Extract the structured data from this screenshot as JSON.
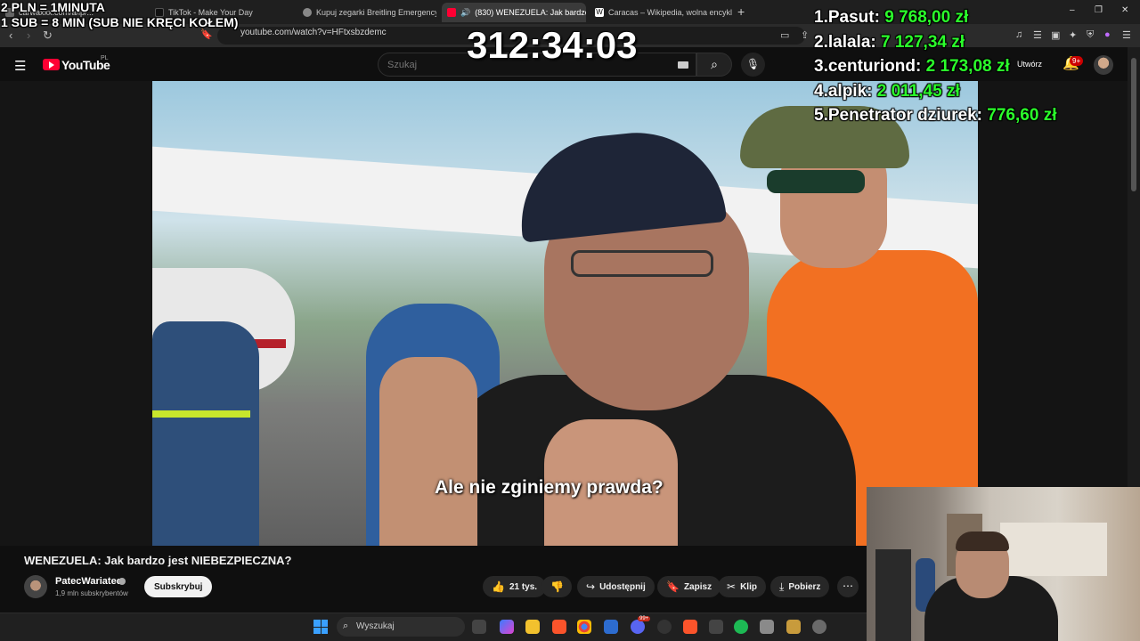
{
  "browser": {
    "tabs": [
      {
        "label": "carwaxxx.com/a/lp/... ",
        "active": false
      },
      {
        "label": "TikTok - Make Your Day",
        "active": false
      },
      {
        "label": "Kupuj zegarki Breitling Emergency II",
        "active": false
      },
      {
        "label": "(830) WENEZUELA: Jak bardzo",
        "active": true
      },
      {
        "label": "Caracas – Wikipedia, wolna encyklop",
        "active": false
      }
    ],
    "new_tab": "+",
    "url": "youtube.com/watch?v=HFtxsbzdemc",
    "window_controls": [
      "–",
      "❐",
      "✕"
    ]
  },
  "youtube": {
    "logo_text": "YouTube",
    "region": "PL",
    "search_placeholder": "Szukaj",
    "create_label": "Utwórz",
    "notifications_badge": "9+",
    "subtitle": "Ale nie zginiemy prawda?",
    "video_title": "WENEZUELA: Jak bardzo jest NIEBEZPIECZNA?",
    "channel_name": "PatecWariatec",
    "channel_subs": "1,9 mln subskrybentów",
    "subscribe_label": "Subskrybuj",
    "likes": "21 tys.",
    "share_label": "Udostępnij",
    "save_label": "Zapisz",
    "clip_label": "Klip",
    "download_label": "Pobierz"
  },
  "overlay": {
    "line1": "2 PLN = 1MINUTA",
    "line2": "1 SUB = 8 MIN (SUB NIE KRĘCI KOŁEM)",
    "timer": "312:34:03",
    "leaderboard": [
      {
        "rank": "1.",
        "name": "Pasut:",
        "amount": "9 768,00 zł"
      },
      {
        "rank": "2.",
        "name": "lalala:",
        "amount": "7 127,34 zł"
      },
      {
        "rank": "3.",
        "name": "centuriond:",
        "amount": "2 173,08 zł"
      },
      {
        "rank": "4.",
        "name": "alpik:",
        "amount": "2 011,45 zł"
      },
      {
        "rank": "5.",
        "name": "Penetrator dziurek:",
        "amount": "776,60 zł"
      }
    ],
    "amount_color": "#2bff2b"
  },
  "taskbar": {
    "search_placeholder": "Wyszukaj",
    "badge": "99+"
  },
  "colors": {
    "yt_red": "#ff0033",
    "background": "#0f0f0f"
  }
}
